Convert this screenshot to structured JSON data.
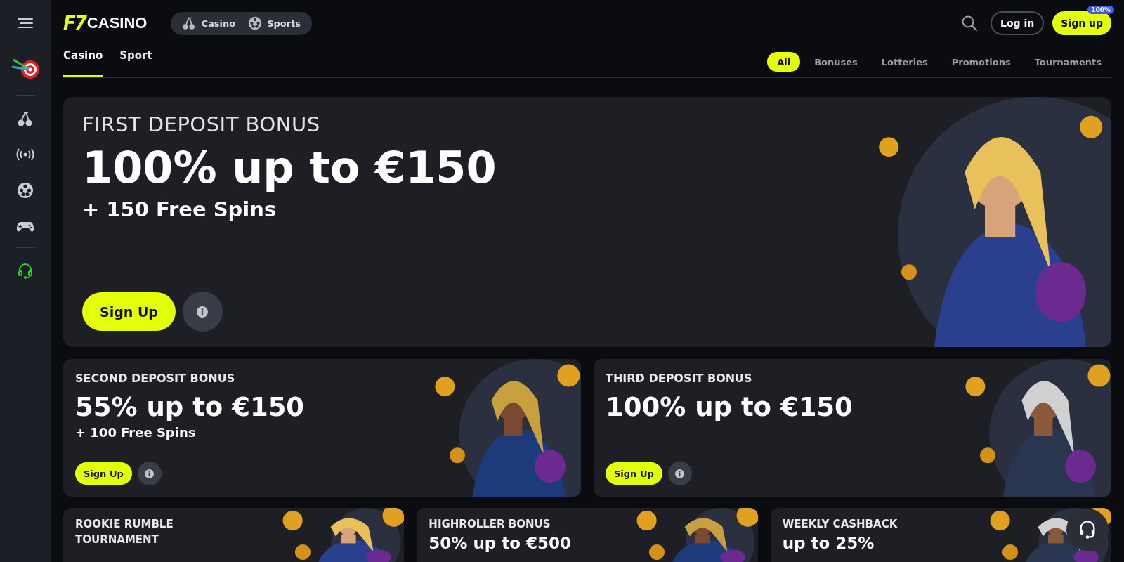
{
  "header": {
    "logo_mark": "F7",
    "logo_text": "CASINO",
    "switch": [
      {
        "label": "Casino",
        "kind": "cherry"
      },
      {
        "label": "Sports",
        "kind": "ball"
      }
    ],
    "login": "Log in",
    "signup": "Sign up",
    "signup_badge": "100%"
  },
  "tabs": [
    {
      "label": "Casino",
      "selected": true
    },
    {
      "label": "Sport",
      "selected": false
    }
  ],
  "filters": [
    {
      "label": "All",
      "selected": true
    },
    {
      "label": "Bonuses",
      "selected": false
    },
    {
      "label": "Lotteries",
      "selected": false
    },
    {
      "label": "Promotions",
      "selected": false
    },
    {
      "label": "Tournaments",
      "selected": false
    }
  ],
  "hero": {
    "title": "FIRST DEPOSIT BONUS",
    "amount": "100% up to €150",
    "extra": "+ 150 Free Spins",
    "button": "Sign Up"
  },
  "cards": [
    {
      "title": "SECOND DEPOSIT BONUS",
      "amount": "55% up to €150",
      "extra": "+ 100 Free Spins",
      "button": "Sign Up"
    },
    {
      "title": "THIRD DEPOSIT BONUS",
      "amount": "100% up to €150",
      "button": "Sign Up"
    }
  ],
  "promos": [
    {
      "title": "ROOKIE RUMBLE TOURNAMENT"
    },
    {
      "title": "HIGHROLLER BONUS",
      "amount": "50% up to €500"
    },
    {
      "title": "WEEKLY CASHBACK",
      "amount": "up to 25%"
    }
  ]
}
